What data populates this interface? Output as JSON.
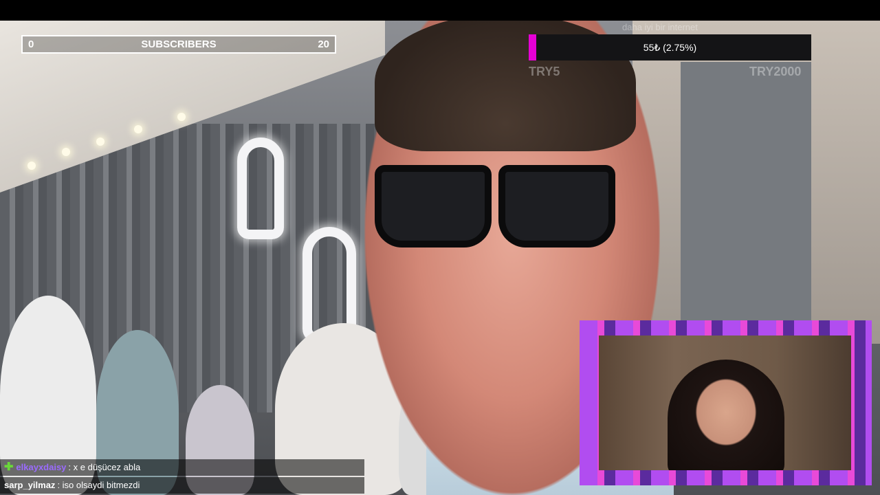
{
  "subscribers_bar": {
    "current": "0",
    "label": "SUBSCRIBERS",
    "goal": "20",
    "progress_fraction": 0
  },
  "donation_goal": {
    "title": "daha iyi bir internet",
    "progress_text": "55₺ (2.75%)",
    "progress_percent": 2.75,
    "min_label": "TRY5",
    "max_label": "TRY2000",
    "fill_color": "#e600d6"
  },
  "chat": {
    "messages": [
      {
        "user": "elkayxdaisy",
        "user_color": "#9b6bff",
        "badge": "plus-icon",
        "text": ": x e düşücez abla"
      },
      {
        "user": "sarp_yilmaz",
        "user_color": "#ffffff",
        "badge": "",
        "text": ": iso olsaydi bitmezdi"
      }
    ]
  },
  "colors": {
    "accent_magenta": "#e600d6",
    "frame_purple": "#b14df0",
    "chat_plus_green": "#6ad83a"
  }
}
